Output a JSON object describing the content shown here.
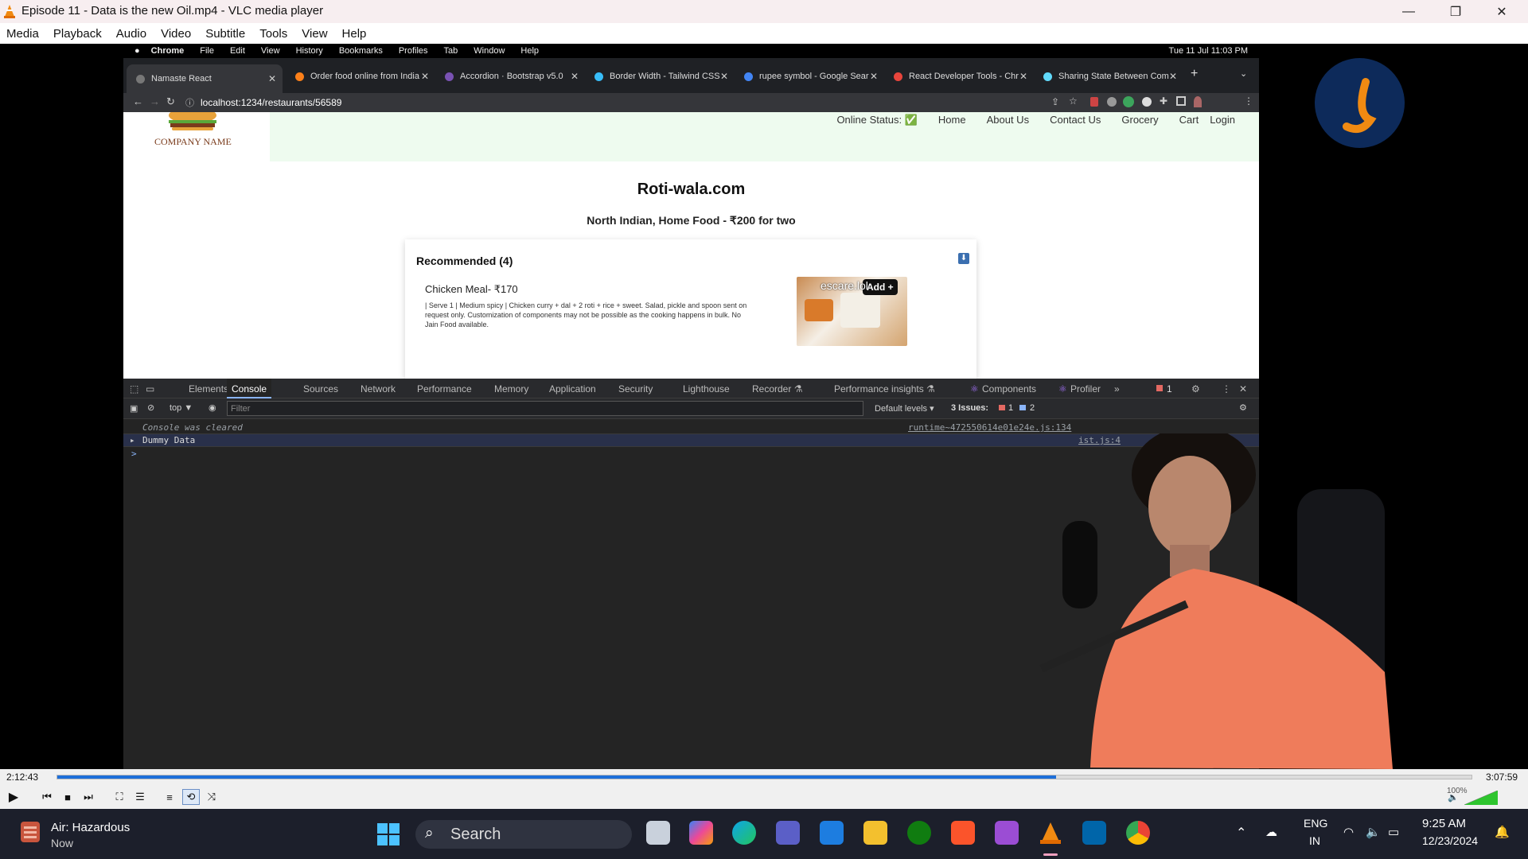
{
  "window": {
    "title": "Episode 11 - Data is the new Oil.mp4 - VLC media player",
    "minimize": "—",
    "restore": "❐",
    "close": "✕"
  },
  "menu": [
    "Media",
    "Playback",
    "Audio",
    "Video",
    "Subtitle",
    "Tools",
    "View",
    "Help"
  ],
  "mac": {
    "menus": [
      "Chrome",
      "File",
      "Edit",
      "View",
      "History",
      "Bookmarks",
      "Profiles",
      "Tab",
      "Window",
      "Help"
    ],
    "clock": "Tue 11 Jul  11:03 PM"
  },
  "chrome": {
    "tabs": [
      {
        "label": "Namaste React",
        "color": "#777777"
      },
      {
        "label": "Order food online from India",
        "color": "#fc8019"
      },
      {
        "label": "Accordion · Bootstrap v5.0",
        "color": "#7952b3"
      },
      {
        "label": "Border Width - Tailwind CSS",
        "color": "#38bdf8"
      },
      {
        "label": "rupee symbol - Google Sear",
        "color": "#4285f4"
      },
      {
        "label": "React Developer Tools - Chr",
        "color": "#e8453c"
      },
      {
        "label": "Sharing State Between Com",
        "color": "#61dafb"
      }
    ],
    "new_tab": "+",
    "url": "localhost:1234/restaurants/56589"
  },
  "site": {
    "company": "COMPANY NAME",
    "online_status": "Online Status: ✅",
    "nav": [
      "Home",
      "About Us",
      "Contact Us",
      "Grocery",
      "Cart",
      "Login"
    ],
    "restaurant": "Roti-wala.com",
    "cuisine": "North Indian, Home Food - ₹200 for two",
    "section": "Recommended (4)",
    "item_name": "Chicken Meal- ₹170",
    "item_desc": "| Serve 1 | Medium spicy | Chicken curry + dal + 2 roti + rice + sweet. Salad, pickle and spoon sent on request only. Customization of components may not be possible as the cooking happens in bulk. No Jain Food available.",
    "add_button": "Add +",
    "overlay_text": "escare.lol"
  },
  "devtools": {
    "tabs": [
      "Elements",
      "Console",
      "Sources",
      "Network",
      "Performance",
      "Memory",
      "Application",
      "Security",
      "Lighthouse",
      "Recorder ⚗",
      "Performance insights ⚗",
      "Components",
      "Profiler"
    ],
    "active_tab": "Console",
    "errors": "1",
    "context": "top ▼",
    "filter_placeholder": "Filter",
    "levels": "Default levels ▾",
    "issues": "3 Issues:",
    "issue_err": "1",
    "issue_info": "2",
    "cleared": "Console was cleared",
    "cleared_src": "runtime~472550614e01e24e.js:134",
    "dummy": "Dummy Data",
    "dummy_src": "ist.js:4",
    "prompt": ">"
  },
  "player": {
    "elapsed": "2:12:43",
    "total": "3:07:59",
    "progress_fraction": 0.706,
    "volume": "100%"
  },
  "taskbar": {
    "weather_title": "Air: Hazardous",
    "weather_sub": "Now",
    "search": "Search",
    "lang_top": "ENG",
    "lang_bottom": "IN",
    "time": "9:25 AM",
    "date": "12/23/2024"
  },
  "colors": {
    "progress": "#1e6fd9",
    "taskbar": "#1c1f2b",
    "header_green": "#eefbef"
  }
}
